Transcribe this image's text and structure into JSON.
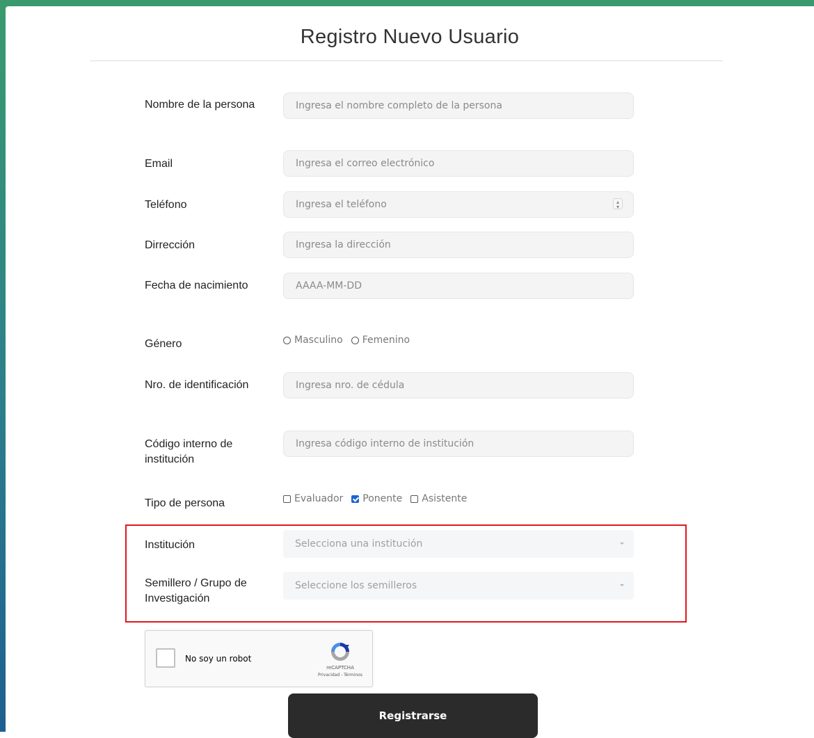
{
  "page": {
    "title": "Registro Nuevo Usuario"
  },
  "fields": {
    "nombre": {
      "label": "Nombre de la persona",
      "placeholder": "Ingresa el nombre completo de la persona"
    },
    "email": {
      "label": "Email",
      "placeholder": "Ingresa el correo electrónico"
    },
    "telefono": {
      "label": "Teléfono",
      "placeholder": "Ingresa el teléfono"
    },
    "direccion": {
      "label": "Dirrección",
      "placeholder": "Ingresa la dirección"
    },
    "fecha": {
      "label": "Fecha de nacimiento",
      "placeholder": "AAAA-MM-DD"
    },
    "genero": {
      "label": "Género",
      "options": [
        "Masculino",
        "Femenino"
      ]
    },
    "identificacion": {
      "label": "Nro. de identificación",
      "placeholder": "Ingresa nro. de cédula"
    },
    "codigo": {
      "label": "Código interno de institución",
      "placeholder": "Ingresa código interno de institución"
    },
    "tipo": {
      "label": "Tipo de persona",
      "options": [
        {
          "label": "Evaluador",
          "checked": false
        },
        {
          "label": "Ponente",
          "checked": true
        },
        {
          "label": "Asistente",
          "checked": false
        }
      ]
    },
    "institucion": {
      "label": "Institución",
      "placeholder": "Selecciona una institución"
    },
    "semillero": {
      "label": "Semillero / Grupo de Investigación",
      "placeholder": "Seleccione los semilleros"
    }
  },
  "captcha": {
    "label": "No soy un robot",
    "brand": "reCAPTCHA",
    "terms": "Privacidad - Términos"
  },
  "submit": {
    "label": "Registrarse"
  },
  "colors": {
    "highlight": "#e0161e",
    "button": "#2b2b2b",
    "checkbox_checked": "#1a66d2"
  }
}
